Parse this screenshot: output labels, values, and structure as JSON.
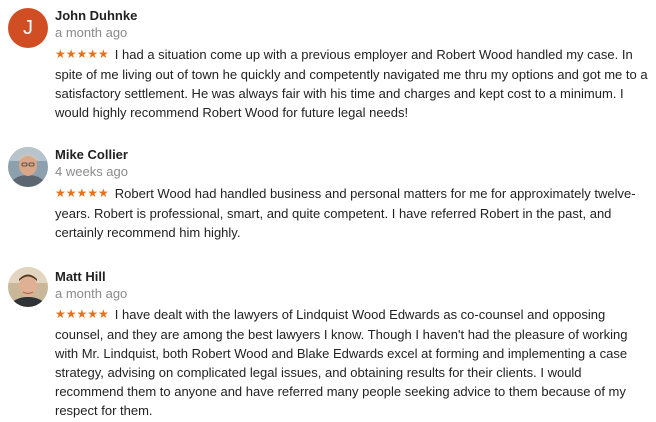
{
  "colors": {
    "star": "#e7711b",
    "initial_avatar_bg": "#d14e25",
    "date_text": "#8a8a8a"
  },
  "reviews": [
    {
      "avatar_initial": "J",
      "avatar_type": "initial",
      "author": "John Duhnke",
      "date": "a month ago",
      "stars": "★★★★★",
      "rating": 5,
      "text": "I had a situation come up with a previous employer and Robert Wood handled my case.  In spite of me living out of town he quickly and competently navigated me thru my options and got me to a satisfactory settlement.  He was always fair with his time and charges and kept cost to a minimum.  I would highly recommend Robert Wood for future legal needs!"
    },
    {
      "avatar_type": "photo",
      "author": "Mike Collier",
      "date": "4 weeks ago",
      "stars": "★★★★★",
      "rating": 5,
      "text": "Robert Wood had handled business and personal matters for me for approximately twelve-years.  Robert is professional, smart, and quite competent.  I have referred Robert in the past, and certainly recommend him highly."
    },
    {
      "avatar_type": "photo",
      "author": "Matt Hill",
      "date": "a month ago",
      "stars": "★★★★★",
      "rating": 5,
      "text": "I have dealt with the lawyers of Lindquist Wood Edwards as co-counsel and opposing counsel,  and they are among the best lawyers I know.  Though I haven't had the pleasure of working with Mr. Lindquist, both Robert Wood and Blake Edwards excel at forming and implementing a case strategy, advising on complicated legal issues, and obtaining results for their clients.  I would recommend them to anyone and have referred many people seeking advice to them because of my respect for them."
    }
  ]
}
